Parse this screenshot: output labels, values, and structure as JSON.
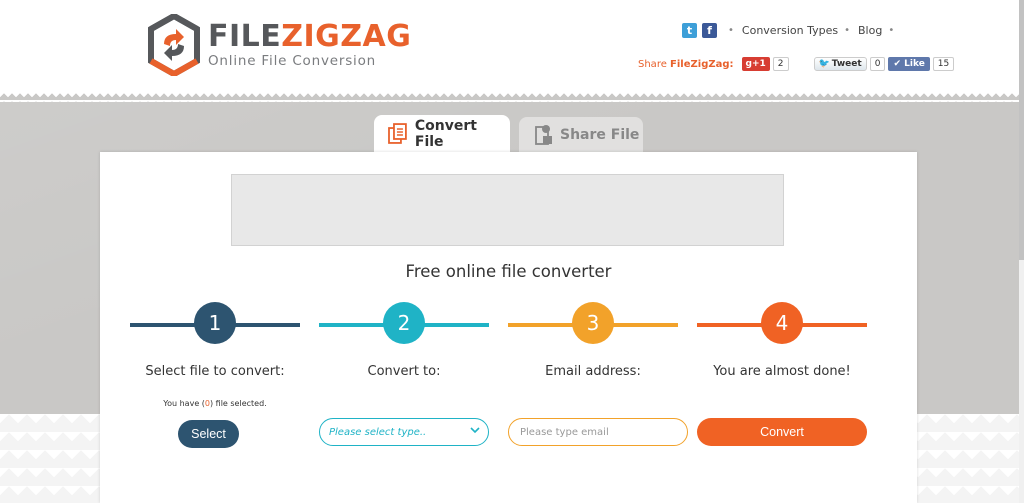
{
  "brand": {
    "name_part1": "FILE",
    "name_part2": "ZIGZAG",
    "tagline": "Online File Conversion"
  },
  "topnav": {
    "social": [
      {
        "name": "twitter",
        "glyph": "t"
      },
      {
        "name": "facebook",
        "glyph": "f"
      }
    ],
    "links": [
      "Conversion Types",
      "Blog"
    ]
  },
  "share": {
    "label_prefix": "Share ",
    "label_brand": "FileZigZag:",
    "gplus_label": "g+1",
    "gplus_count": "2",
    "tweet_label": "Tweet",
    "tweet_count": "0",
    "like_label": "Like",
    "like_count": "15"
  },
  "tabs": [
    {
      "label": "Convert File",
      "active": true
    },
    {
      "label": "Share File",
      "active": false
    }
  ],
  "main": {
    "title": "Free online file converter",
    "steps": [
      {
        "number": "1",
        "label": "Select file to convert:",
        "color": "#2d5470"
      },
      {
        "number": "2",
        "label": "Convert to:",
        "color": "#1fb3c6"
      },
      {
        "number": "3",
        "label": "Email address:",
        "color": "#f2a22a"
      },
      {
        "number": "4",
        "label": "You are almost done!",
        "color": "#f06224"
      }
    ],
    "selection_info": {
      "prefix": "You have (",
      "count": "0",
      "suffix": ") file selected."
    },
    "select_button": "Select",
    "type_select_placeholder": "Please select type..",
    "email_placeholder": "Please type email",
    "convert_button": "Convert"
  }
}
